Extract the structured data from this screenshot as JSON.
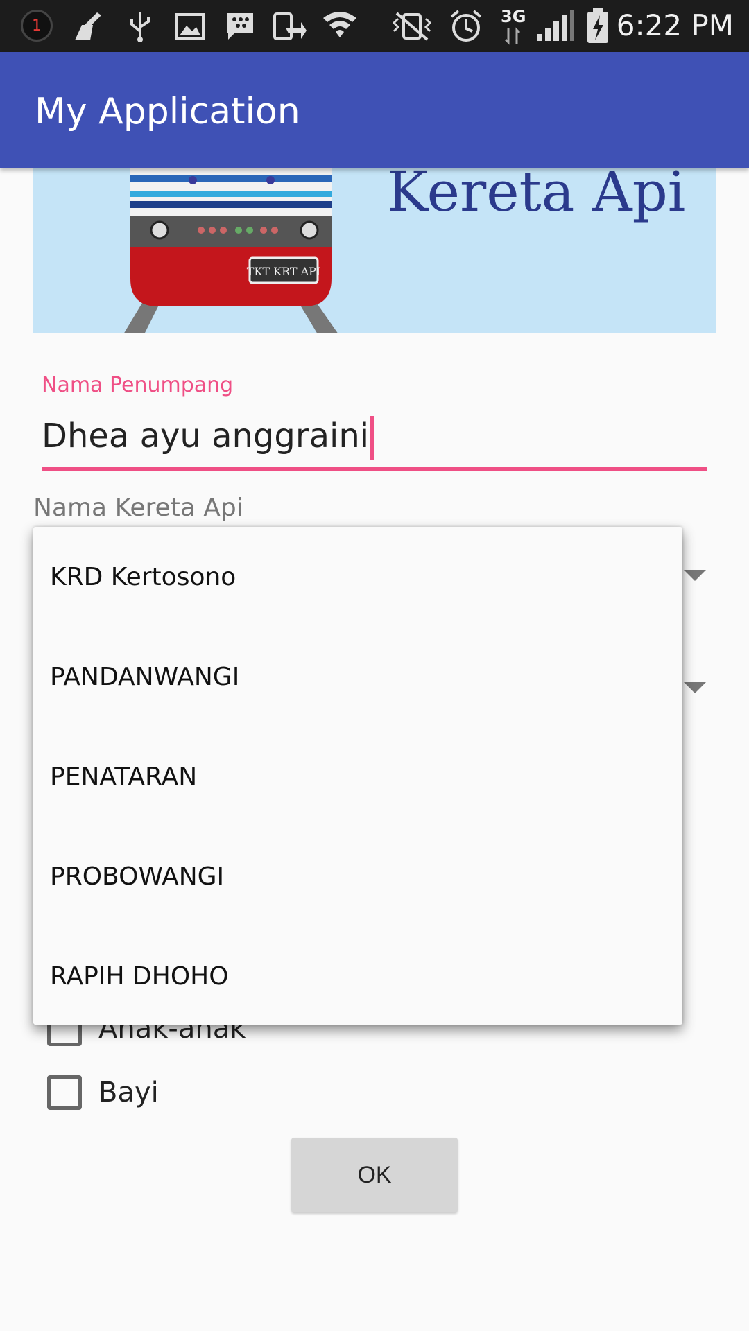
{
  "status_bar": {
    "notification_count": "1",
    "network": "3G",
    "time": "6:22 PM"
  },
  "app_bar": {
    "title": "My Application"
  },
  "banner": {
    "text": "Kereta Api",
    "ticket_label": "TKT KRT API"
  },
  "form": {
    "passenger_label": "Nama Penumpang",
    "passenger_value": "Dhea ayu anggraini",
    "train_label": "Nama Kereta Api",
    "checkboxes": [
      {
        "label": "Anak-anak",
        "checked": false
      },
      {
        "label": "Bayi",
        "checked": false
      }
    ],
    "ok_label": "OK"
  },
  "dropdown": {
    "options": [
      "KRD Kertosono",
      "PANDANWANGI",
      "PENATARAN",
      "PROBOWANGI",
      "RAPIH DHOHO"
    ]
  },
  "colors": {
    "primary": "#3f51b5",
    "accent": "#ef4f85",
    "status_bar": "#1c1c1c"
  }
}
